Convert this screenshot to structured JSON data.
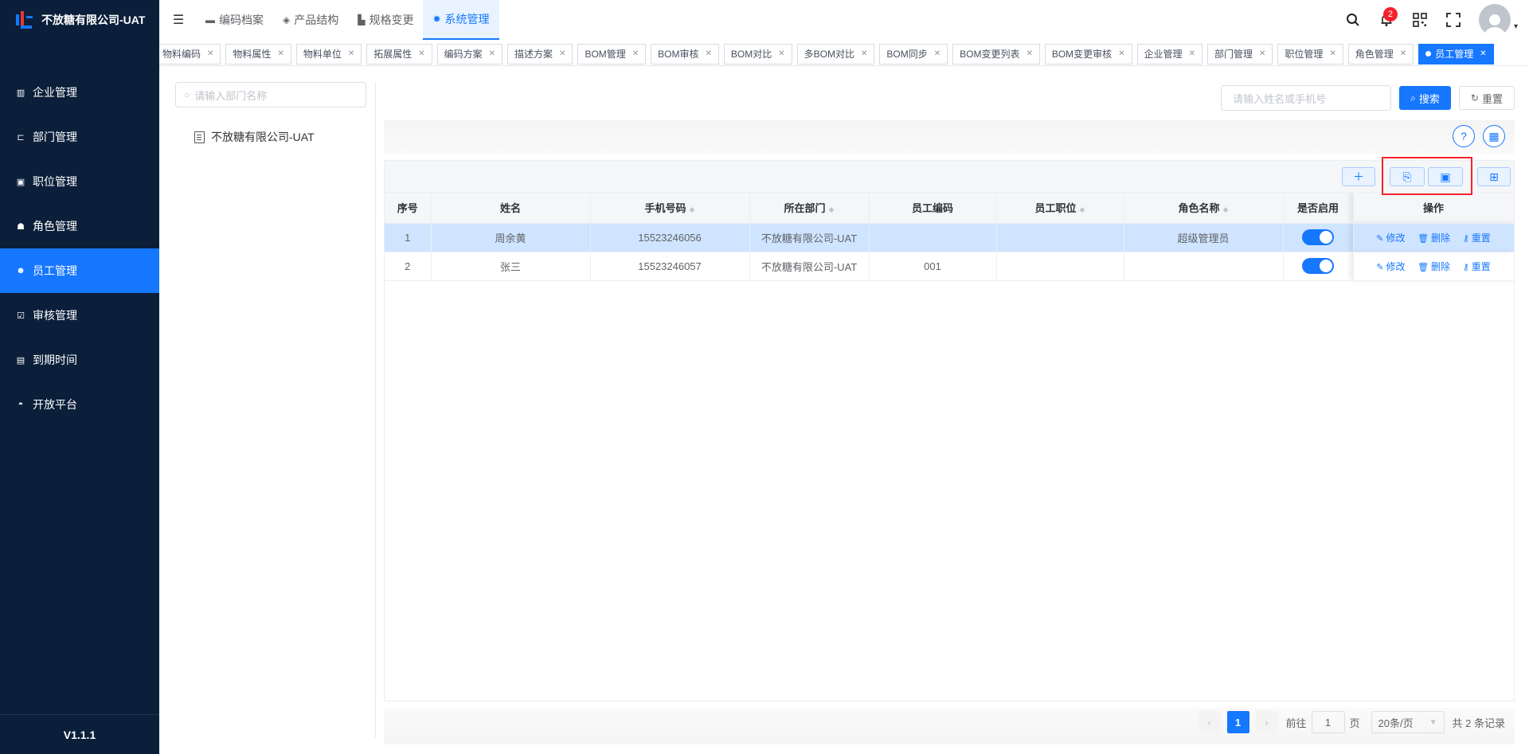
{
  "app": {
    "title": "不放糖有限公司-UAT",
    "version": "V1.1.1"
  },
  "sidebar": {
    "items": [
      {
        "label": "企业管理",
        "icon": "building-icon",
        "active": false
      },
      {
        "label": "部门管理",
        "icon": "org-tree-icon",
        "active": false
      },
      {
        "label": "职位管理",
        "icon": "id-card-icon",
        "active": false
      },
      {
        "label": "角色管理",
        "icon": "user-group-icon",
        "active": false
      },
      {
        "label": "员工管理",
        "icon": "user-icon",
        "active": true
      },
      {
        "label": "审核管理",
        "icon": "checkbox-icon",
        "active": false
      },
      {
        "label": "到期时间",
        "icon": "calendar-icon",
        "active": false
      },
      {
        "label": "开放平台",
        "icon": "platform-icon",
        "active": false
      }
    ]
  },
  "header": {
    "tabs": [
      {
        "label": "编码档案",
        "icon": "folder-icon"
      },
      {
        "label": "产品结构",
        "icon": "layers-icon"
      },
      {
        "label": "规格变更",
        "icon": "spec-icon"
      },
      {
        "label": "系统管理",
        "icon": "gear-icon",
        "active": true
      }
    ],
    "notification_count": "2"
  },
  "tags": [
    "物料编码",
    "物料属性",
    "物料单位",
    "拓展属性",
    "编码方案",
    "描述方案",
    "BOM管理",
    "BOM审核",
    "BOM对比",
    "多BOM对比",
    "BOM同步",
    "BOM变更列表",
    "BOM变更审核",
    "企业管理",
    "部门管理",
    "职位管理",
    "角色管理",
    "员工管理"
  ],
  "dept_panel": {
    "search_placeholder": "请输入部门名称",
    "tree_root": "不放糖有限公司-UAT"
  },
  "search": {
    "placeholder": "请输入姓名或手机号",
    "search_label": "搜索",
    "reset_label": "重置"
  },
  "table": {
    "columns": [
      "序号",
      "姓名",
      "手机号码",
      "所在部门",
      "员工编码",
      "员工职位",
      "角色名称",
      "是否启用",
      "操作"
    ],
    "rows": [
      {
        "index": "1",
        "name": "周余黄",
        "phone": "15523246056",
        "dept": "不放糖有限公司-UAT",
        "code": "",
        "position": "",
        "role": "超级管理员",
        "enabled": true
      },
      {
        "index": "2",
        "name": "张三",
        "phone": "15523246057",
        "dept": "不放糖有限公司-UAT",
        "code": "001",
        "position": "",
        "role": "",
        "enabled": true
      }
    ],
    "actions": {
      "edit": "修改",
      "delete": "删除",
      "reset": "重置"
    }
  },
  "pagination": {
    "current": "1",
    "goto_prefix": "前往",
    "goto_value": "1",
    "goto_suffix": "页",
    "page_size": "20条/页",
    "total": "共 2 条记录"
  },
  "colors": {
    "primary": "#1677ff",
    "sidebar_bg": "#0b1f3a",
    "highlight": "#f5222d"
  }
}
